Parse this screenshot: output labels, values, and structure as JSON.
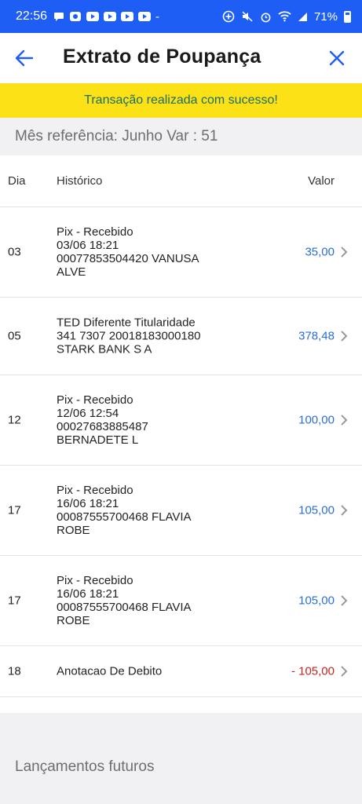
{
  "status_bar": {
    "time": "22:56",
    "dash": "-",
    "battery_text": "71%",
    "icons": [
      "chat-bubble-icon",
      "cloud-icon",
      "youtube-icon",
      "youtube-icon",
      "youtube-icon",
      "youtube-icon",
      "add-circle-icon",
      "mute-icon",
      "alarm-icon",
      "wifi-icon",
      "signal-icon",
      "battery-icon"
    ]
  },
  "header": {
    "title": "Extrato de Poupança",
    "back_icon": "arrow-left-icon",
    "close_icon": "close-icon",
    "accent_color": "#1f5ef5"
  },
  "banner": {
    "message": "Transação realizada com sucesso!",
    "background": "#fbe115"
  },
  "reference": {
    "label": "Mês referência: Junho Var : 51"
  },
  "table": {
    "columns": {
      "day": "Dia",
      "history": "Histórico",
      "value": "Valor"
    },
    "rows": [
      {
        "day": "03",
        "lines": [
          "Pix - Recebido",
          "03/06 18:21",
          "00077853504420 VANUSA",
          "ALVE"
        ],
        "value": "35,00",
        "negative": false
      },
      {
        "day": "05",
        "lines": [
          "TED Diferente Titularidade",
          "341 7307 20018183000180",
          "STARK BANK S A"
        ],
        "value": "378,48",
        "negative": false
      },
      {
        "day": "12",
        "lines": [
          "Pix - Recebido",
          "12/06 12:54",
          "00027683885487",
          "BERNADETE L"
        ],
        "value": "100,00",
        "negative": false
      },
      {
        "day": "17",
        "lines": [
          "Pix - Recebido",
          "16/06 18:21",
          "00087555700468 FLAVIA",
          "ROBE"
        ],
        "value": "105,00",
        "negative": false
      },
      {
        "day": "17",
        "lines": [
          "Pix - Recebido",
          "16/06 18:21",
          "00087555700468 FLAVIA",
          "ROBE"
        ],
        "value": "105,00",
        "negative": false
      },
      {
        "day": "18",
        "lines": [
          "Anotacao De Debito"
        ],
        "value": "- 105,00",
        "negative": true
      }
    ]
  },
  "future": {
    "title": "Lançamentos futuros"
  },
  "colors": {
    "positive_value": "#2a6fd6",
    "negative_value": "#c8231e",
    "banner_text": "#1c6e64"
  }
}
